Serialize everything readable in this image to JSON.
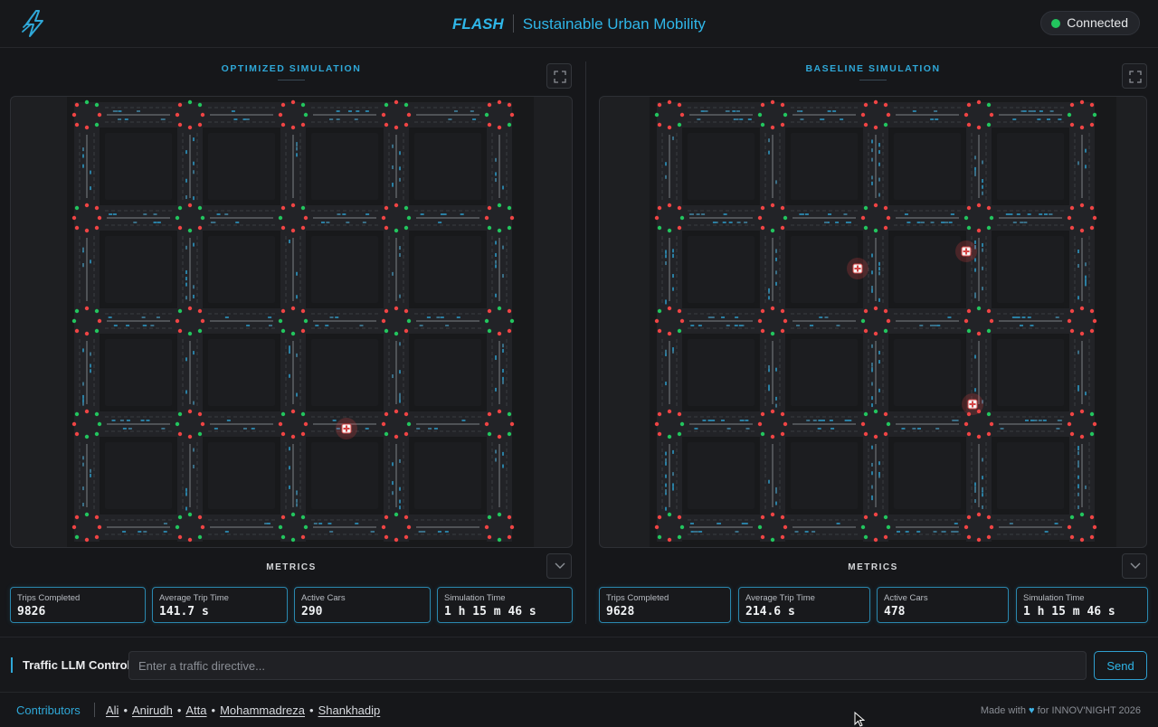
{
  "header": {
    "brand": "FLASH",
    "subtitle": "Sustainable Urban Mobility",
    "status": "Connected",
    "status_color": "#22c55e",
    "logo_icon": "lightning-logo-icon"
  },
  "accent_color": "#2fb6e8",
  "optimized": {
    "title": "OPTIMIZED SIMULATION",
    "metrics_title": "METRICS",
    "metrics": [
      {
        "label": "Trips Completed",
        "value": "9826"
      },
      {
        "label": "Average Trip Time",
        "value": "141.7 s"
      },
      {
        "label": "Active Cars",
        "value": "290"
      },
      {
        "label": "Simulation Time",
        "value": "1 h 15 m 46 s"
      }
    ]
  },
  "baseline": {
    "title": "BASELINE SIMULATION",
    "metrics_title": "METRICS",
    "metrics": [
      {
        "label": "Trips Completed",
        "value": "9628"
      },
      {
        "label": "Average Trip Time",
        "value": "214.6 s"
      },
      {
        "label": "Active Cars",
        "value": "478"
      },
      {
        "label": "Simulation Time",
        "value": "1 h 15 m 46 s"
      }
    ]
  },
  "control": {
    "label": "Traffic LLM Control",
    "placeholder": "Enter a traffic directive...",
    "send": "Send"
  },
  "footer": {
    "contributors_label": "Contributors",
    "contributors": [
      "Ali",
      "Anirudh",
      "Atta",
      "Mohammadreza",
      "Shankhadip"
    ],
    "made_with_prefix": "Made with",
    "made_with_suffix": "for INNOV'NIGHT 2026"
  }
}
